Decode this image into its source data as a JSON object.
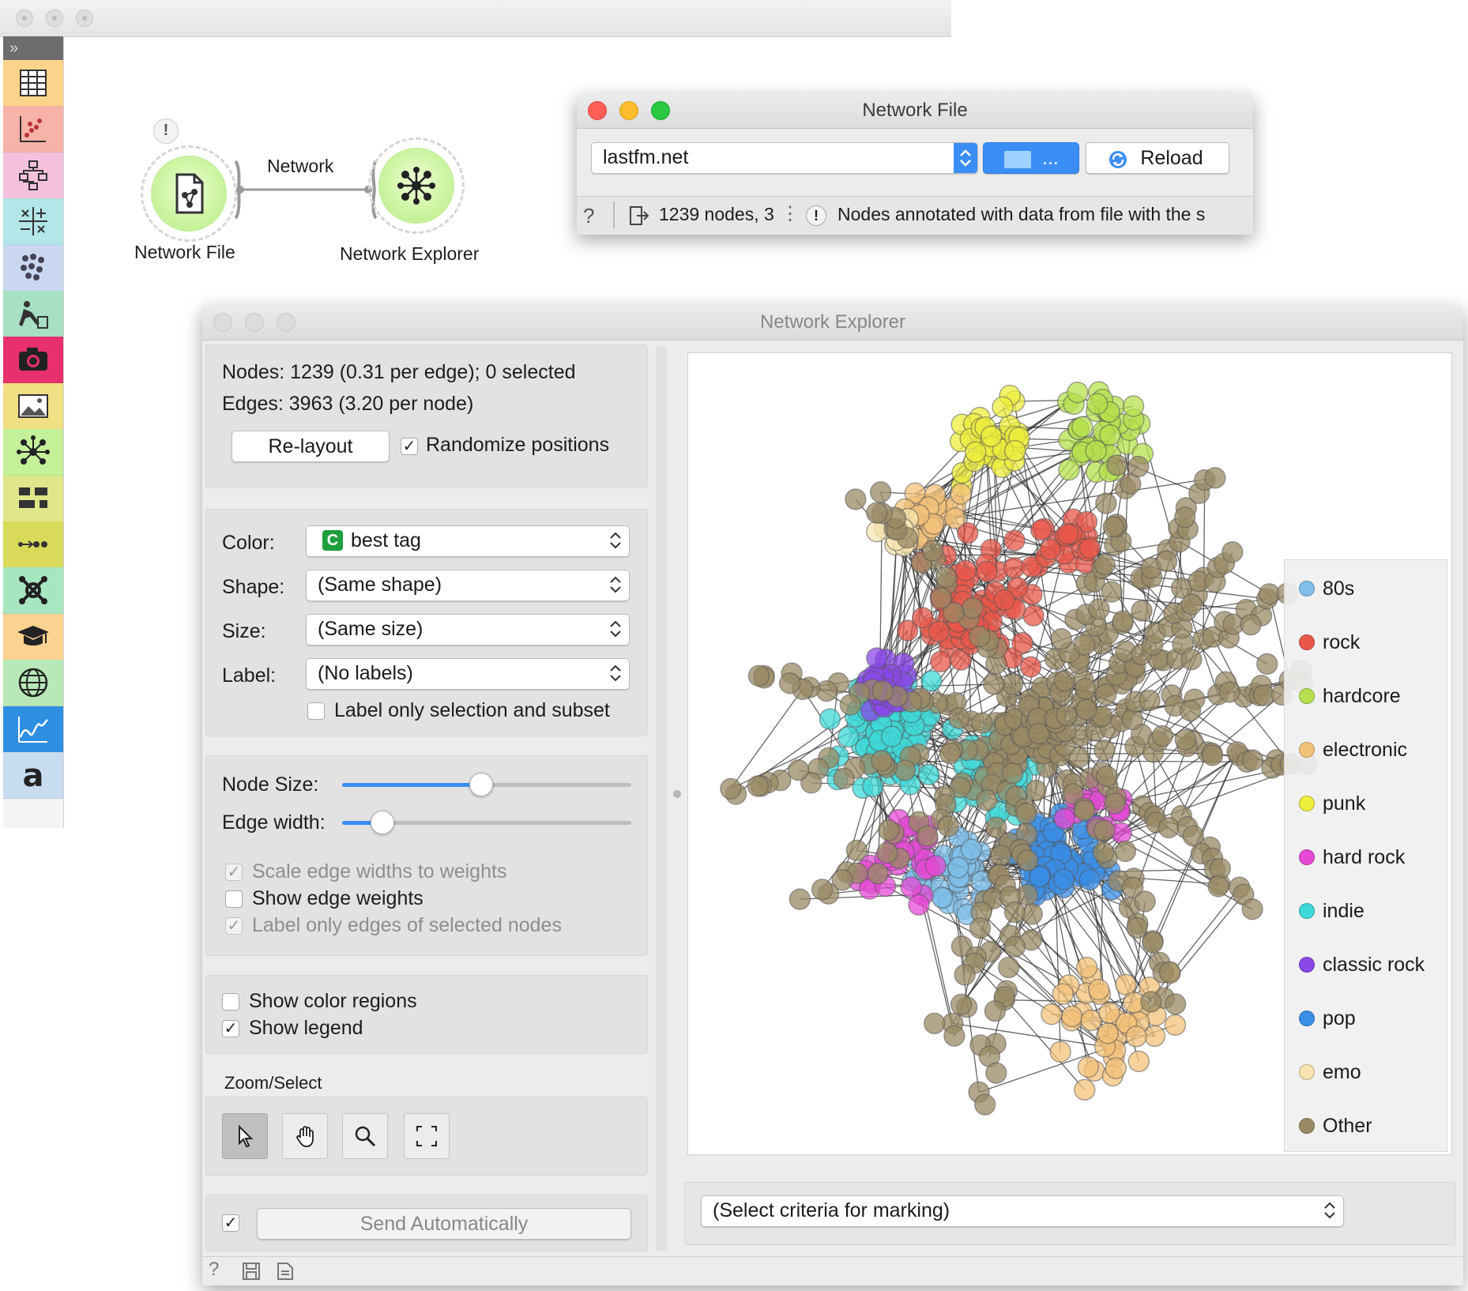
{
  "workflow": {
    "node_file_label": "Network File",
    "node_explorer_label": "Network Explorer",
    "link_label": "Network",
    "warning_badge": "!"
  },
  "toolbox": {
    "toggle": "»",
    "items": [
      {
        "icon": "data-table-icon",
        "color": "#fbd38a"
      },
      {
        "icon": "scatter-plot-icon",
        "color": "#f7b3a8"
      },
      {
        "icon": "tree-icon",
        "color": "#f4c1dc"
      },
      {
        "icon": "confusion-matrix-icon",
        "color": "#b2e6e8"
      },
      {
        "icon": "clustering-icon",
        "color": "#c9d8f0"
      },
      {
        "icon": "text-mining-icon",
        "color": "#a8e0c4"
      },
      {
        "icon": "camera-icon",
        "color": "#e8316c"
      },
      {
        "icon": "image-icon",
        "color": "#f0e083"
      },
      {
        "icon": "network-icon",
        "color": "#c4f09a"
      },
      {
        "icon": "timeseries-icon",
        "color": "#e0e68a"
      },
      {
        "icon": "bioinformatics-icon",
        "color": "#d9d95a"
      },
      {
        "icon": "single-cell-icon",
        "color": "#a8e6c0"
      },
      {
        "icon": "education-icon",
        "color": "#fbd28f"
      },
      {
        "icon": "geo-icon",
        "color": "#b8e8b8"
      },
      {
        "icon": "spectroscopy-icon",
        "color": "#2f8fe0"
      },
      {
        "icon": "text-icon",
        "color": "#c8dcf0"
      }
    ]
  },
  "network_file": {
    "title": "Network File",
    "file_value": "lastfm.net",
    "browse_label": "...",
    "reload_label": "Reload",
    "status_info": "1239 nodes, 3",
    "status_warning": "Nodes annotated with data from file with the s"
  },
  "explorer": {
    "title": "Network Explorer",
    "nodes_info": "Nodes: 1239 (0.31 per edge); 0 selected",
    "edges_info": "Edges: 3963 (3.20 per node)",
    "relayout_label": "Re-layout",
    "randomize_label": "Randomize positions",
    "randomize_checked": "✓",
    "color_label": "Color:",
    "color_value": "best tag",
    "color_badge": "C",
    "shape_label": "Shape:",
    "shape_value": "(Same shape)",
    "size_label": "Size:",
    "size_value": "(Same size)",
    "label_label": "Label:",
    "label_value": "(No labels)",
    "label_only_sel": "Label only selection and subset",
    "node_size_label": "Node Size:",
    "node_size_level": 0.48,
    "edge_width_label": "Edge width:",
    "edge_width_level": 0.14,
    "scale_edges": "Scale edge widths to weights",
    "show_edge_weights": "Show edge weights",
    "label_edges_sel": "Label only edges of selected nodes",
    "show_color_regions": "Show color regions",
    "show_legend": "Show legend",
    "zoom_select": "Zoom/Select",
    "send_auto": "Send Automatically",
    "marking_value": "(Select criteria for marking)",
    "checkmark": "✓"
  },
  "legend": [
    {
      "label": "80s",
      "color": "#7fbfea"
    },
    {
      "label": "rock",
      "color": "#e8574a"
    },
    {
      "label": "hardcore",
      "color": "#b6e04e"
    },
    {
      "label": "electronic",
      "color": "#f3c27a"
    },
    {
      "label": "punk",
      "color": "#eeee3e"
    },
    {
      "label": "hard rock",
      "color": "#e64ad6"
    },
    {
      "label": "indie",
      "color": "#3fd8d8"
    },
    {
      "label": "classic rock",
      "color": "#8b48e8"
    },
    {
      "label": "pop",
      "color": "#3a8ee6"
    },
    {
      "label": "emo",
      "color": "#f7e4b0"
    },
    {
      "label": "Other",
      "color": "#9a8a64"
    }
  ]
}
